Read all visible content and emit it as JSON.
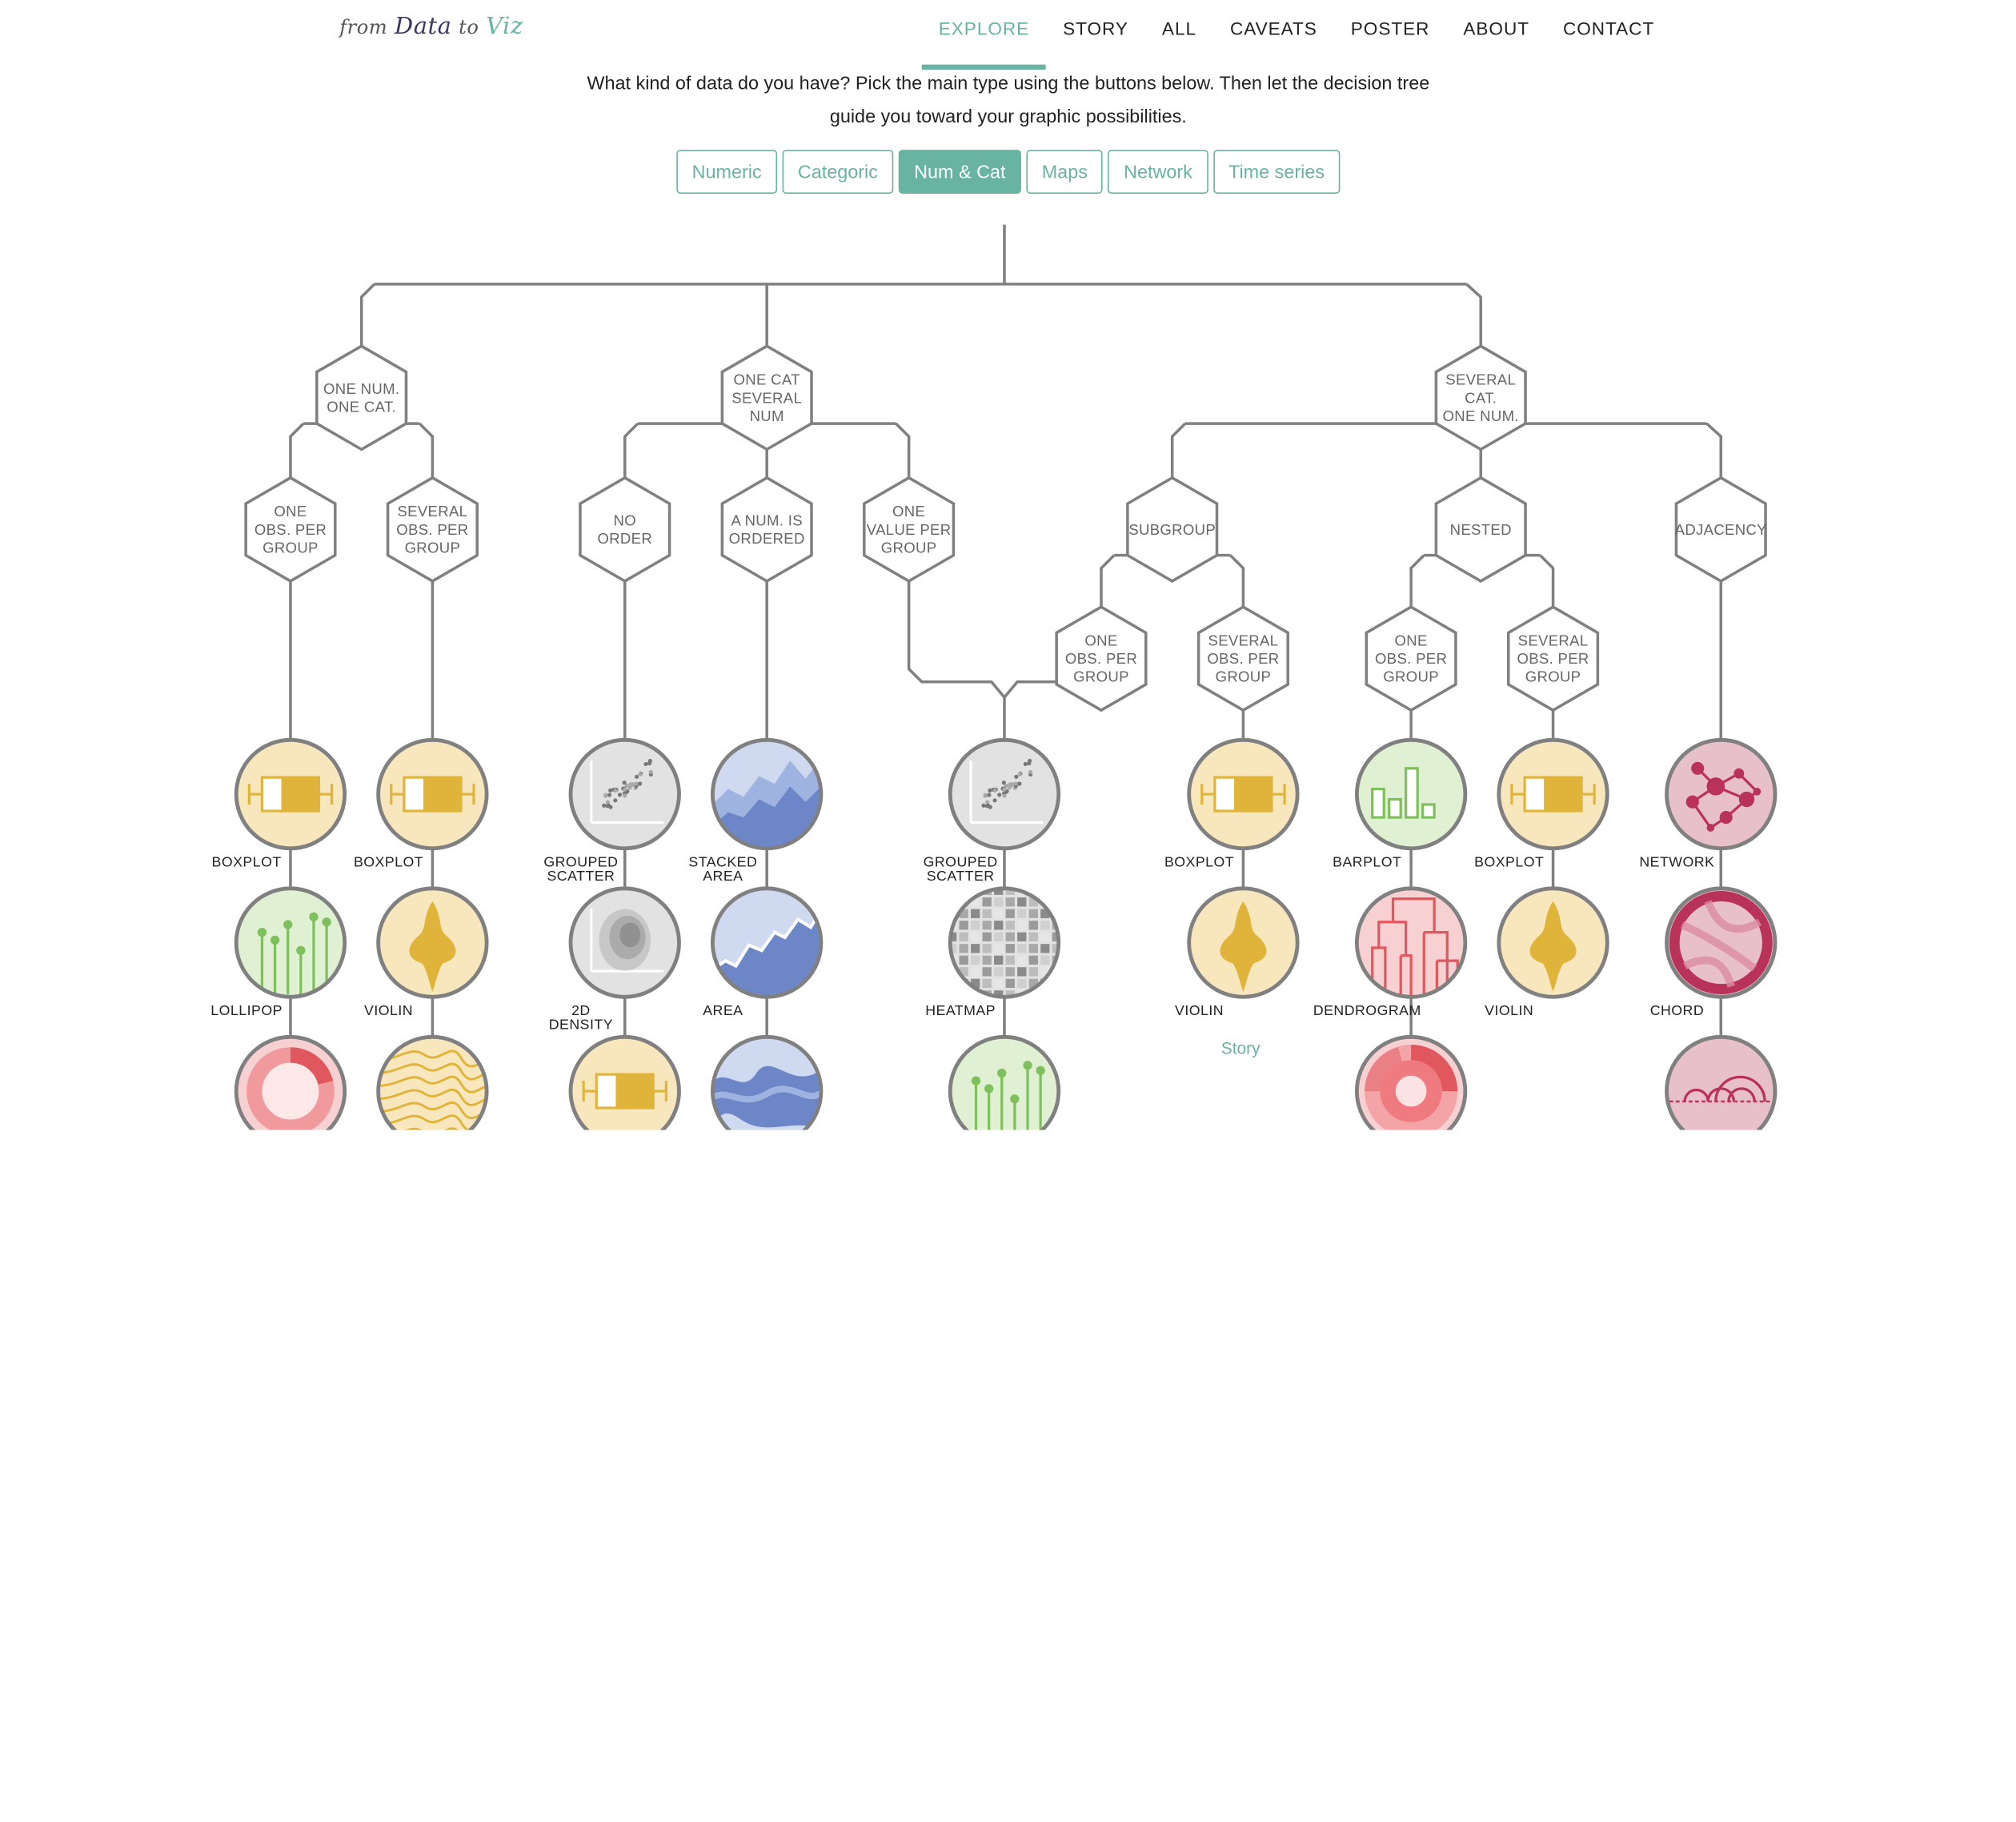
{
  "logo": {
    "w1": "from",
    "w2": "Data",
    "w3": "to",
    "w4": "Viz"
  },
  "nav": [
    {
      "label": "EXPLORE",
      "active": true
    },
    {
      "label": "STORY"
    },
    {
      "label": "ALL"
    },
    {
      "label": "CAVEATS"
    },
    {
      "label": "POSTER"
    },
    {
      "label": "ABOUT"
    },
    {
      "label": "CONTACT"
    }
  ],
  "intro": {
    "line1": "What kind of data do you have? Pick the main type using the buttons below. Then let the decision tree",
    "line2": "guide you toward your graphic possibilities."
  },
  "types": [
    {
      "label": "Numeric"
    },
    {
      "label": "Categoric"
    },
    {
      "label": "Num & Cat",
      "active": true
    },
    {
      "label": "Maps"
    },
    {
      "label": "Network"
    },
    {
      "label": "Time series"
    }
  ],
  "colors": {
    "accent": "#69b3a2",
    "line": "#808080",
    "yellow_fill": "#f8e6bd",
    "yellow_mark": "#e0b43a",
    "green_fill": "#e0f0d2",
    "green_mark": "#7fbf5e",
    "grey_fill": "#e2e2e2",
    "grey_mark": "#777777",
    "blue_fill": "#cfd9f0",
    "blue_mark": "#6c86c8",
    "red_fill": "#f7d0d2",
    "red_mark": "#e0575e",
    "maroon_fill": "#e8c0ca",
    "maroon_mark": "#b8325a"
  },
  "diagram": {
    "hexagons": {
      "one_num_one_cat": [
        "ONE NUM.",
        "ONE CAT."
      ],
      "one_cat_several_num": [
        "ONE CAT",
        "SEVERAL",
        "NUM"
      ],
      "several_cat_one_num": [
        "SEVERAL",
        "CAT.",
        "ONE NUM."
      ],
      "obs_one_a": [
        "ONE",
        "OBS. PER",
        "GROUP"
      ],
      "obs_several_a": [
        "SEVERAL",
        "OBS. PER",
        "GROUP"
      ],
      "no_order": [
        "NO",
        "ORDER"
      ],
      "num_ordered": [
        "A NUM. IS",
        "ORDERED"
      ],
      "one_value": [
        "ONE",
        "VALUE PER",
        "GROUP"
      ],
      "subgroup": [
        "SUBGROUP"
      ],
      "nested": [
        "NESTED"
      ],
      "adjacency": [
        "ADJACENCY"
      ],
      "sub_one": [
        "ONE",
        "OBS. PER",
        "GROUP"
      ],
      "sub_several": [
        "SEVERAL",
        "OBS. PER",
        "GROUP"
      ],
      "nest_one": [
        "ONE",
        "OBS. PER",
        "GROUP"
      ],
      "nest_several": [
        "SEVERAL",
        "OBS. PER",
        "GROUP"
      ]
    },
    "plots": {
      "c1_1": [
        "BOXPLOT"
      ],
      "c1_2": [
        "LOLLIPOP"
      ],
      "c2_1": [
        "BOXPLOT"
      ],
      "c2_2": [
        "VIOLIN"
      ],
      "c3_1": [
        "GROUPED",
        "SCATTER"
      ],
      "c3_2": [
        "2D",
        "DENSITY"
      ],
      "c4_1": [
        "STACKED",
        "AREA"
      ],
      "c4_2": [
        "AREA"
      ],
      "c5_1": [
        "GROUPED",
        "SCATTER"
      ],
      "c5_2": [
        "HEATMAP"
      ],
      "c6_1": [
        "BOXPLOT"
      ],
      "c6_2": [
        "VIOLIN"
      ],
      "c7_1": [
        "BARPLOT"
      ],
      "c7_2": [
        "DENDROGRAM"
      ],
      "c8_1": [
        "BOXPLOT"
      ],
      "c8_2": [
        "VIOLIN"
      ],
      "c9_1": [
        "NETWORK"
      ],
      "c9_2": [
        "CHORD"
      ]
    },
    "story_link": "Story"
  }
}
